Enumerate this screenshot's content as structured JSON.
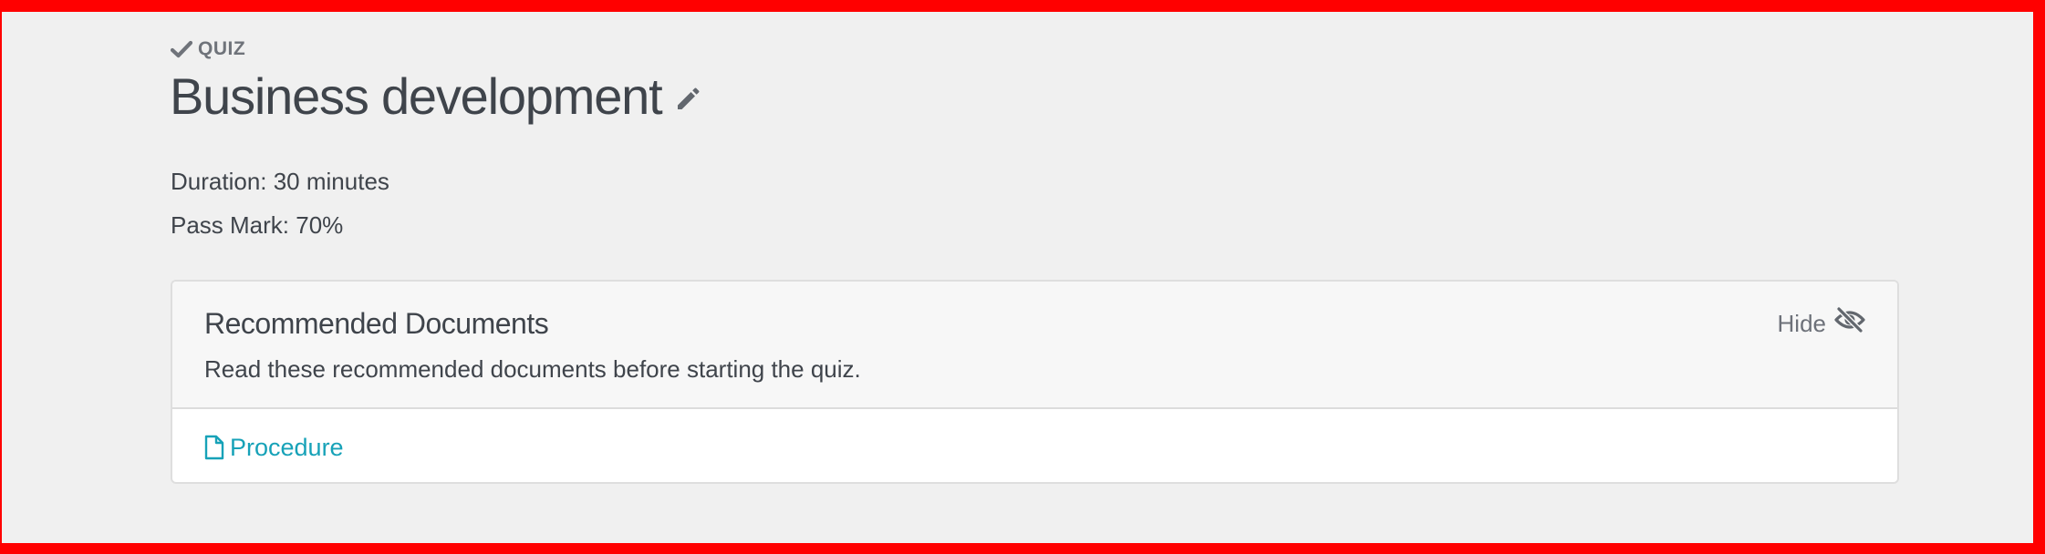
{
  "header": {
    "kicker": "QUIZ",
    "kicker_icon": "check-icon",
    "title": "Business development",
    "edit_icon": "pencil-icon"
  },
  "details": {
    "duration": "Duration: 30 minutes",
    "pass_mark": "Pass Mark: 70%"
  },
  "recommended": {
    "title": "Recommended Documents",
    "description": "Read these recommended documents before starting the quiz.",
    "hide_label": "Hide",
    "hide_icon": "eye-slash-icon",
    "documents": [
      {
        "label": "Procedure",
        "icon": "file-icon"
      }
    ]
  },
  "colors": {
    "frame_border": "#ff0000",
    "background": "#f0f0f0",
    "link": "#17a2b8",
    "text": "#3f444b",
    "muted": "#6f737a"
  }
}
